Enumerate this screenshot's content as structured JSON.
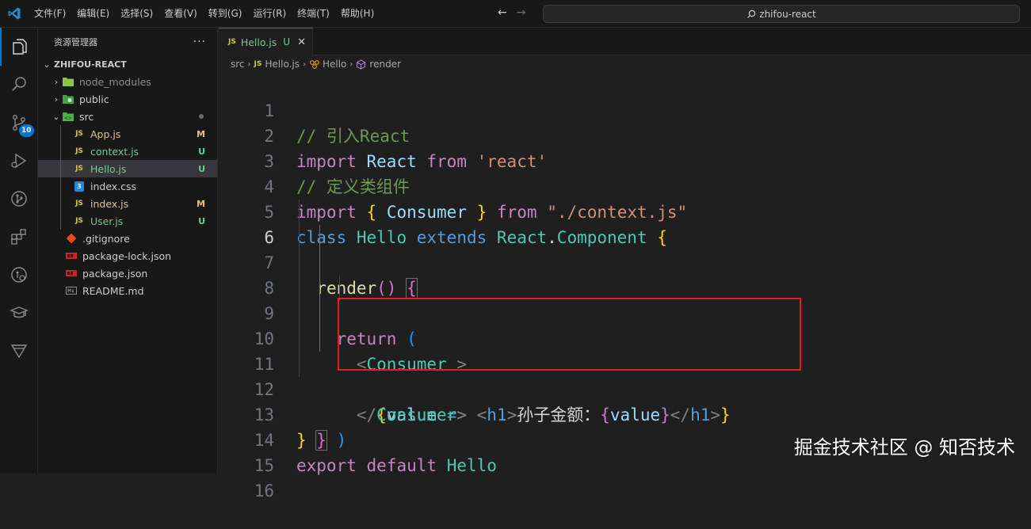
{
  "menu": [
    "文件(F)",
    "编辑(E)",
    "选择(S)",
    "查看(V)",
    "转到(G)",
    "运行(R)",
    "终端(T)",
    "帮助(H)"
  ],
  "search": {
    "text": "zhifou-react"
  },
  "activity": {
    "scm_badge": "10"
  },
  "sidebar": {
    "title": "资源管理器",
    "more": "···",
    "root": "ZHIFOU-REACT",
    "items": [
      {
        "label": "node_modules",
        "status": ""
      },
      {
        "label": "public",
        "status": ""
      },
      {
        "label": "src",
        "status": ""
      },
      {
        "label": "App.js",
        "status": "M"
      },
      {
        "label": "context.js",
        "status": "U"
      },
      {
        "label": "Hello.js",
        "status": "U"
      },
      {
        "label": "index.css",
        "status": ""
      },
      {
        "label": "index.js",
        "status": "M"
      },
      {
        "label": "User.js",
        "status": "U"
      },
      {
        "label": ".gitignore",
        "status": ""
      },
      {
        "label": "package-lock.json",
        "status": ""
      },
      {
        "label": "package.json",
        "status": ""
      },
      {
        "label": "README.md",
        "status": ""
      }
    ]
  },
  "tab": {
    "js": "JS",
    "name": "Hello.js",
    "status": "U",
    "close": "✕"
  },
  "breadcrumb": {
    "src": "src",
    "js": "JS",
    "file": "Hello.js",
    "class": "Hello",
    "method": "render"
  },
  "line_numbers": [
    "1",
    "2",
    "3",
    "4",
    "5",
    "6",
    "7",
    "8",
    "9",
    "10",
    "11",
    "12",
    "13",
    "14",
    "15",
    "16"
  ],
  "code": {
    "l1": "// 引入React",
    "l2_import": "import",
    "l2_react": "React",
    "l2_from": "from",
    "l2_str": "'react'",
    "l3": "// 定义类组件",
    "l4_import": "import",
    "l4_open": "{",
    "l4_consumer": "Consumer",
    "l4_close": "}",
    "l4_from": "from",
    "l4_str": "\"./context.js\"",
    "l5_class": "class",
    "l5_hello": "Hello",
    "l5_extends": "extends",
    "l5_react": "React",
    "l5_dot": ".",
    "l5_comp": "Component",
    "l5_brace": "{",
    "l6_render": "render",
    "l6_parens": "()",
    "l6_brace": "{",
    "l7_return": "return",
    "l7_paren": "(",
    "l8_lt": "<",
    "l8_tag": "Consumer",
    "l8_gt": " >",
    "l9_open": "{",
    "l9_value": "value",
    "l9_arrow": "=>",
    "l9_lt": "<",
    "l9_h1": "h1",
    "l9_gt": ">",
    "l9_text": "孙子金额：",
    "l9_iopen": "{",
    "l9_ivalue": "value",
    "l9_iclose": "}",
    "l9_clt": "</",
    "l9_ch1": "h1",
    "l9_cgt": ">",
    "l9_close": "}",
    "l10_lt": "</",
    "l10_tag": "Consumer",
    "l10_gt": ">",
    "l11_paren": ")",
    "l12_brace": "}",
    "l13_brace": "}",
    "l14_export": "export",
    "l14_default": "default",
    "l14_hello": "Hello"
  },
  "watermark": "掘金技术社区 @ 知否技术",
  "colors": {
    "accent": "#0078d4",
    "highlight_box": "#e0201f",
    "modified": "#e2c08d",
    "untracked": "#73c991"
  }
}
